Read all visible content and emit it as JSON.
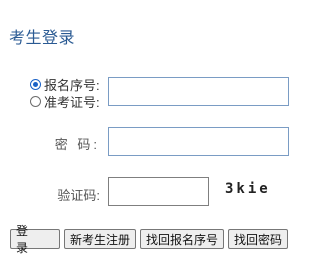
{
  "page": {
    "title": "考生登录"
  },
  "login_form": {
    "id_type_options": [
      {
        "label": "报名序号:",
        "selected": true
      },
      {
        "label": "准考证号:",
        "selected": false
      }
    ],
    "id_value": "",
    "password_label": "密 码:",
    "password_value": "",
    "captcha_label": "验证码:",
    "captcha_value": "",
    "captcha_image_text": "3kie"
  },
  "buttons": {
    "login": "登 录",
    "register": "新考生注册",
    "recover_id": "找回报名序号",
    "recover_password": "找回密码"
  },
  "colors": {
    "title": "#2a5a93",
    "input_border": "#7a9cc4",
    "radio_selected": "#1a62c7"
  }
}
